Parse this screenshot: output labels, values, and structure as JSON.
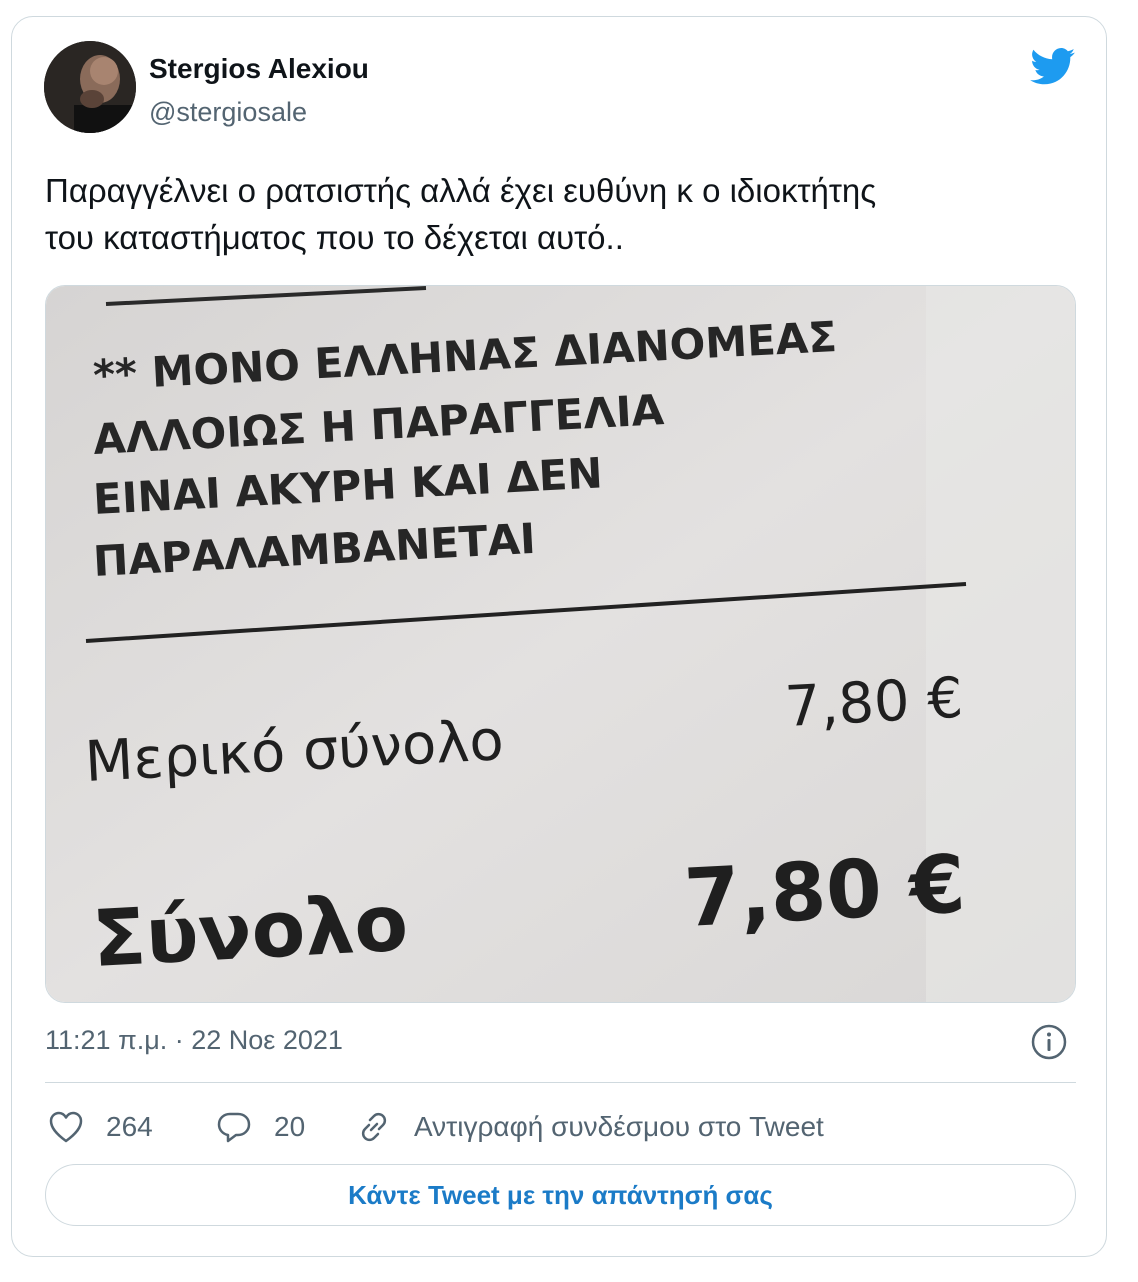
{
  "tweet": {
    "author_name": "Stergios Alexiou",
    "author_handle": "@stergiosale",
    "text_line1": "Παραγγέλνει ο ρατσιστής αλλά έχει ευθύνη κ ο ιδιοκτήτης",
    "text_line2": "του καταστήματος που το δέχεται αυτό..",
    "timestamp": "11:21 π.μ. · 22 Νοε 2021",
    "likes": "264",
    "replies": "20",
    "copy_link_label": "Αντιγραφή συνδέσμου στο Tweet",
    "reply_button_label": "Κάντε Tweet με την απάντησή σας"
  },
  "receipt": {
    "line1": "** ΜΟΝΟ ΕΛΛΗΝΑΣ ΔΙΑΝΟΜΕΑΣ",
    "line2": "ΑΛΛΟΙΩΣ Η ΠΑΡΑΓΓΕΛΙΑ",
    "line3": "ΕΙΝΑΙ ΑΚΥΡΗ ΚΑΙ ΔΕΝ",
    "line4": "ΠΑΡΑΛΑΜΒΑΝΕΤΑΙ",
    "subtotal_label": "Μερικό σύνολο",
    "subtotal_value": "7,80 €",
    "total_label": "Σύνολο",
    "total_value": "7,80 €"
  },
  "icons": {
    "brand": "twitter-bird-icon",
    "info": "info-icon",
    "like": "heart-icon",
    "reply": "speech-bubble-icon",
    "link": "link-icon"
  },
  "colors": {
    "brand_blue": "#1d9bf0",
    "secondary_text": "#536471",
    "border": "#cfd9de"
  }
}
